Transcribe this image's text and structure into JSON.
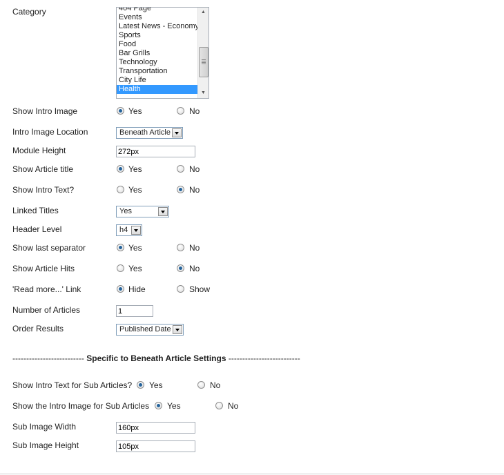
{
  "category": {
    "label": "Category",
    "items": [
      "404 Page",
      "Events",
      "Latest News - Economy",
      "Sports",
      "Food",
      "Bar Grills",
      "Technology",
      "Transportation",
      "City Life",
      "Health"
    ],
    "selected": "Health"
  },
  "show_intro_image": {
    "label": "Show Intro Image",
    "yes": "Yes",
    "no": "No",
    "value": "Yes"
  },
  "intro_image_location": {
    "label": "Intro Image Location",
    "value": "Beneath Article"
  },
  "module_height": {
    "label": "Module Height",
    "value": "272px"
  },
  "show_article_title": {
    "label": "Show Article title",
    "yes": "Yes",
    "no": "No",
    "value": "Yes"
  },
  "show_intro_text": {
    "label": "Show Intro Text?",
    "yes": "Yes",
    "no": "No",
    "value": "No"
  },
  "linked_titles": {
    "label": "Linked Titles",
    "value": "Yes"
  },
  "header_level": {
    "label": "Header Level",
    "value": "h4"
  },
  "show_last_separator": {
    "label": "Show last separator",
    "yes": "Yes",
    "no": "No",
    "value": "Yes"
  },
  "show_article_hits": {
    "label": "Show Article Hits",
    "yes": "Yes",
    "no": "No",
    "value": "No"
  },
  "read_more_link": {
    "label": "'Read more...' Link",
    "hide": "Hide",
    "show": "Show",
    "value": "Hide"
  },
  "number_of_articles": {
    "label": "Number of Articles",
    "value": "1"
  },
  "order_results": {
    "label": "Order Results",
    "value": "Published Date"
  },
  "divider": {
    "left": "--------------------------",
    "title": "Specific to Beneath Article Settings",
    "right": "--------------------------"
  },
  "sub_intro_text": {
    "label": "Show Intro Text for Sub Articles?",
    "yes": "Yes",
    "no": "No",
    "value": "Yes"
  },
  "sub_intro_image": {
    "label": "Show the Intro Image for Sub Articles",
    "yes": "Yes",
    "no": "No",
    "value": "Yes"
  },
  "sub_image_width": {
    "label": "Sub Image Width",
    "value": "160px"
  },
  "sub_image_height": {
    "label": "Sub Image Height",
    "value": "105px"
  }
}
